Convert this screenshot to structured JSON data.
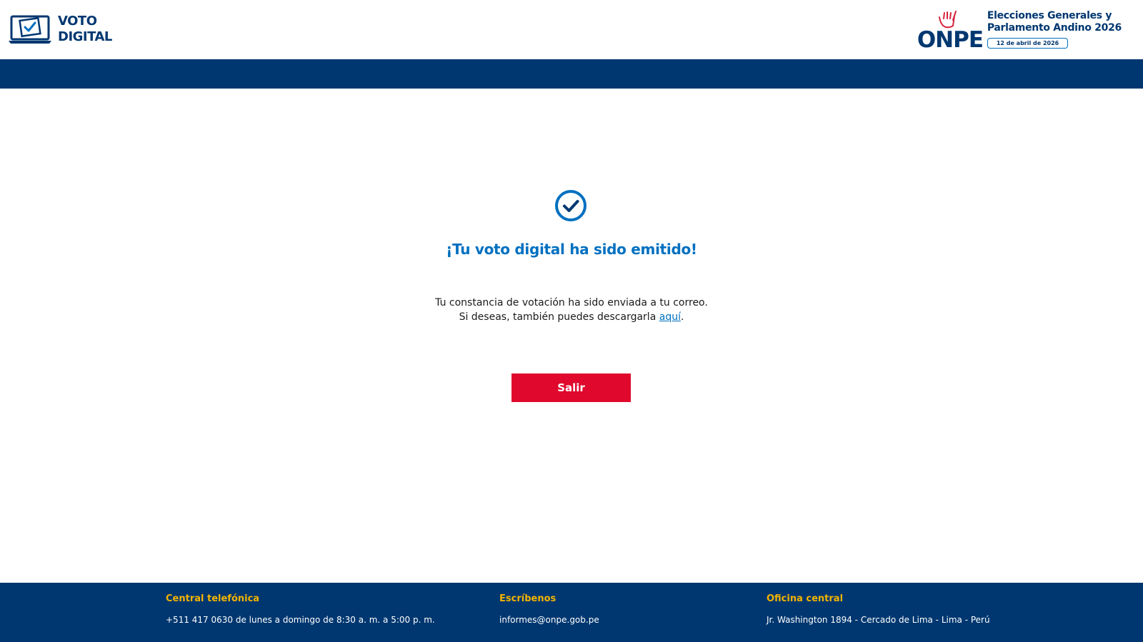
{
  "header": {
    "logo_line1": "VOTO",
    "logo_line2": "DIGITAL",
    "onpe_word": "ONPE",
    "election_line1": "Elecciones Generales y",
    "election_line2": "Parlamento Andino 2026",
    "election_date": "12 de abril de 2026"
  },
  "main": {
    "icon": "check-circle-icon",
    "title": "¡Tu voto digital ha sido emitido!",
    "message_line1": "Tu constancia de votación ha sido enviada a tu correo.",
    "message_line2_prefix": "Si deseas, también puedes descargarla ",
    "download_link": "aquí",
    "message_line2_suffix": ".",
    "exit_button": "Salir"
  },
  "footer": {
    "phone_heading": "Central telefónica",
    "phone_text": "+511 417 0630 de lunes a domingo de 8:30 a. m. a 5:00 p. m.",
    "email_heading": "Escríbenos",
    "email_text": "informes@onpe.gob.pe",
    "office_heading": "Oficina central",
    "office_text": "Jr. Washington 1894 - Cercado de Lima - Lima - Perú"
  },
  "colors": {
    "brand_blue": "#003770",
    "accent_blue": "#0070c0",
    "exit_red": "#e0082c",
    "footer_heading": "#f5b400"
  }
}
